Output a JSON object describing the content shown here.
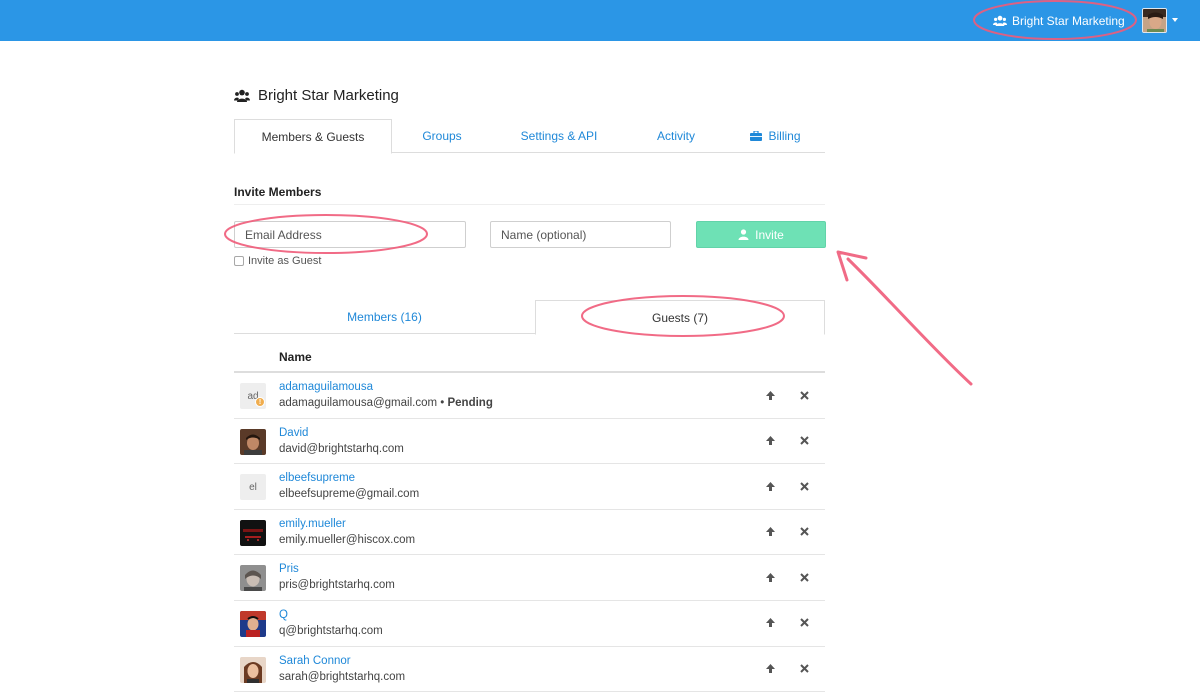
{
  "topbar": {
    "team_name": "Bright Star Marketing",
    "team_icon": "users-icon",
    "avatar_icon": "user-avatar",
    "color": "#2b96e6"
  },
  "org": {
    "title": "Bright Star Marketing"
  },
  "tabs": [
    {
      "label": "Members & Guests",
      "active": true
    },
    {
      "label": "Groups",
      "active": false
    },
    {
      "label": "Settings & API",
      "active": false
    },
    {
      "label": "Activity",
      "active": false
    },
    {
      "label": "Billing",
      "active": false,
      "icon": "briefcase-icon"
    }
  ],
  "invite": {
    "section_title": "Invite Members",
    "email_placeholder": "Email Address",
    "name_placeholder": "Name (optional)",
    "button_label": "Invite",
    "guest_label": "Invite as Guest"
  },
  "subtabs": {
    "members_label": "Members (16)",
    "guests_label": "Guests (7)"
  },
  "table": {
    "column_name": "Name",
    "rows": [
      {
        "name": "adamaguilamousa",
        "email": "adamaguilamousa@gmail.com",
        "status": "Pending",
        "avatar_text": "ad",
        "pending": true
      },
      {
        "name": "David",
        "email": "david@brightstarhq.com",
        "status": "",
        "avatar_text": "",
        "pending": false
      },
      {
        "name": "elbeefsupreme",
        "email": "elbeefsupreme@gmail.com",
        "status": "",
        "avatar_text": "el",
        "pending": false
      },
      {
        "name": "emily.mueller",
        "email": "emily.mueller@hiscox.com",
        "status": "",
        "avatar_text": "",
        "pending": false
      },
      {
        "name": "Pris",
        "email": "pris@brightstarhq.com",
        "status": "",
        "avatar_text": "",
        "pending": false
      },
      {
        "name": "Q",
        "email": "q@brightstarhq.com",
        "status": "",
        "avatar_text": "",
        "pending": false
      },
      {
        "name": "Sarah Connor",
        "email": "sarah@brightstarhq.com",
        "status": "",
        "avatar_text": "",
        "pending": false
      }
    ]
  },
  "colors": {
    "link": "#1f88d8",
    "invite_button": "#6ee1b5",
    "annotation": "#ef5b79"
  }
}
